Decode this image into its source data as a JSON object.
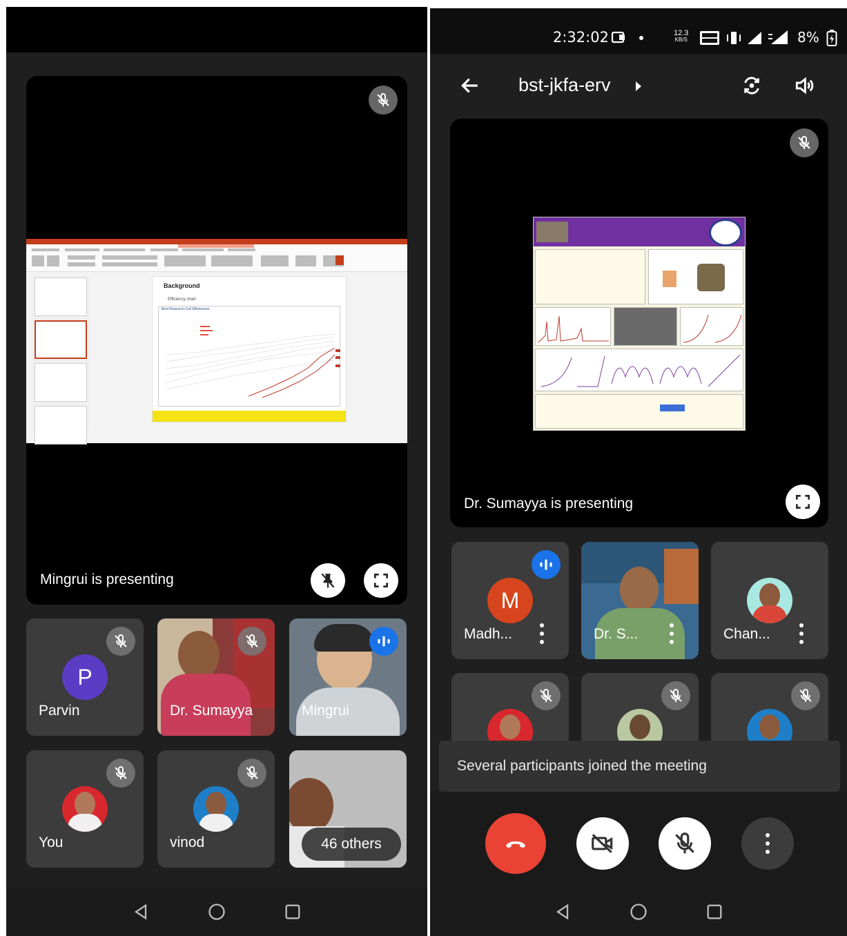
{
  "left": {
    "presenter_label": "Mingrui is presenting",
    "slide": {
      "title": "Background",
      "bullet": "Efficiency chart",
      "chart_title": "Best Research-Cell Efficiencies"
    },
    "participants": [
      {
        "name": "Parvin",
        "initial": "P",
        "avatar_color": "#5b3cc4",
        "muted": true
      },
      {
        "name": "Dr. Sumayya",
        "muted": true
      },
      {
        "name": "Mingrui",
        "speaking": true
      },
      {
        "name": "You",
        "muted": true
      },
      {
        "name": "vinod",
        "muted": true
      },
      {
        "name": "46 others"
      }
    ]
  },
  "right": {
    "status": {
      "time": "2:32:02",
      "data_rate_top": "12.3",
      "data_rate_unit": "KB/S",
      "battery": "8%"
    },
    "meeting_code": "bst-jkfa-erv",
    "presenter_label": "Dr. Sumayya is presenting",
    "participants": [
      {
        "name": "Madh...",
        "initial": "M",
        "avatar_color": "#d6451d",
        "speaking": true
      },
      {
        "name": "Dr. S..."
      },
      {
        "name": "Chan..."
      },
      {
        "name": "",
        "muted": true
      },
      {
        "name": "",
        "muted": true
      },
      {
        "name": "",
        "muted": true
      }
    ],
    "toast": "Several participants joined the meeting",
    "colors": {
      "end_call": "#ea4335",
      "speaking": "#1a73e8"
    }
  },
  "icons": [
    "mic-off-icon",
    "pin-off-icon",
    "fullscreen-icon",
    "voice-activity-icon",
    "back-arrow-icon",
    "switch-camera-icon",
    "speaker-icon",
    "hang-up-icon",
    "camera-off-icon",
    "more-vert-icon",
    "nav-back-icon",
    "nav-home-icon",
    "nav-recents-icon"
  ]
}
